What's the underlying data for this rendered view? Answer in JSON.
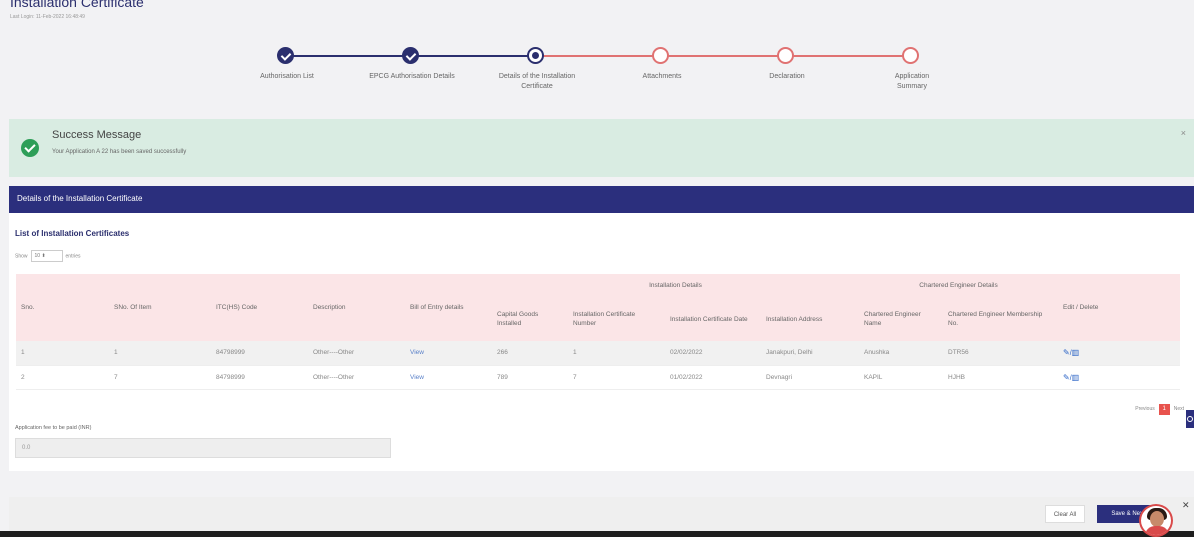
{
  "header": {
    "title": "Installation Certificate",
    "last_login": "Last Login: 11-Feb-2022 16:48:49"
  },
  "stepper": {
    "steps": [
      {
        "label": "Authorisation List",
        "state": "done"
      },
      {
        "label": "EPCG Authorisation Details",
        "state": "done"
      },
      {
        "label": "Details of the Installation Certificate",
        "state": "active"
      },
      {
        "label": "Attachments",
        "state": "pending"
      },
      {
        "label": "Declaration",
        "state": "pending"
      },
      {
        "label": "Application Summary",
        "state": "pending"
      }
    ],
    "colors": {
      "done": "#2b2f6e",
      "pending": "#e07272"
    }
  },
  "success": {
    "title": "Success Message",
    "message": "Your Application A                          22 has been saved successfully",
    "close": "×"
  },
  "section": {
    "title": "Details of the Installation Certificate"
  },
  "list": {
    "title": "List of Installation Certificates",
    "show_label": "Show",
    "entries_value": "10",
    "entries_label": "entries"
  },
  "table": {
    "group_headers": {
      "installation": "Installation Details",
      "engineer": "Chartered Engineer Details"
    },
    "columns": [
      "Sno.",
      "SNo. Of Item",
      "ITC(HS) Code",
      "Description",
      "Bill of Entry details",
      "Capital Goods Installed",
      "Installation Certificate Number",
      "Installation Certificate Date",
      "Installation Address",
      "Chartered Engineer Name",
      "Chartered Engineer Membership No.",
      "Edit / Delete"
    ],
    "rows": [
      {
        "sno": "1",
        "item": "1",
        "itc": "84798999",
        "desc": "Other----Other",
        "boe": "View",
        "goods": "266",
        "cert_no": "1",
        "cert_date": "02/02/2022",
        "address": "Janakpuri, Delhi",
        "eng_name": "Anushka",
        "eng_no": "DTR56"
      },
      {
        "sno": "2",
        "item": "7",
        "itc": "84798999",
        "desc": "Other----Other",
        "boe": "View",
        "goods": "789",
        "cert_no": "7",
        "cert_date": "01/02/2022",
        "address": "Devnagri",
        "eng_name": "KAPIL",
        "eng_no": "HJHB"
      }
    ]
  },
  "pagination": {
    "previous": "Previous",
    "current": "1",
    "next": "Next"
  },
  "fee": {
    "label": "Application fee to be paid (INR)",
    "value": "0.0"
  },
  "footer": {
    "clear": "Clear All",
    "save": "Save & Next"
  },
  "chat": {
    "close": "✕"
  },
  "accent": "#2b2f7d"
}
